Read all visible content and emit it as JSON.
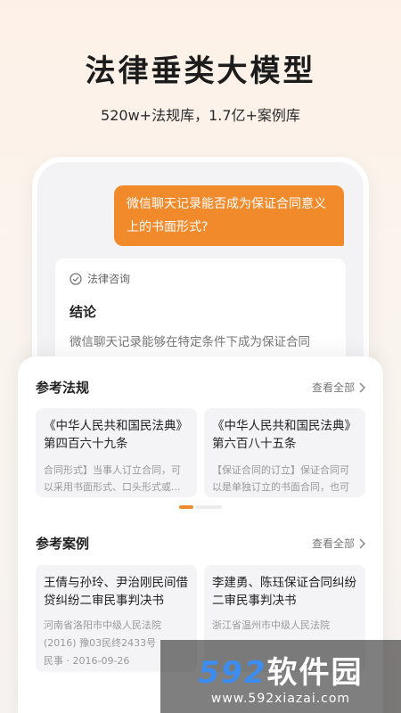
{
  "hero": {
    "title": "法律垂类大模型",
    "subtitle": "520w+法规库，1.7亿+案例库"
  },
  "chat": {
    "question": "微信聊天记录能否成为保证合同意义上的书面形式?",
    "answer_tag": "法律咨询",
    "answer_heading": "结论",
    "answer_text": "微信聊天记录能够在特定条件下成为保证合同"
  },
  "regulations": {
    "title": "参考法规",
    "view_all": "查看全部",
    "cards": [
      {
        "title": "《中华人民共和国民法典》第四百六十九条",
        "snippet": "合同形式】当事人订立合同，可以采用书面形式、口头形式或..."
      },
      {
        "title": "《中华人民共和国民法典》第六百八十五条",
        "snippet": "【保证合同的订立】保证合同可以是单独订立的书面合同，也可"
      }
    ]
  },
  "cases": {
    "title": "参考案例",
    "view_all": "查看全部",
    "cards": [
      {
        "title": "王倩与孙玲、尹治刚民间借贷纠纷二审民事判决书",
        "court": "河南省洛阳市中级人民法院",
        "case_no": "(2016) 豫03民终2433号",
        "meta": "民事 · 2016-09-26"
      },
      {
        "title": "李建勇、陈珏保证合同纠纷二审民事判决书",
        "court": "浙江省温州市中级人民法院",
        "case_no": "",
        "meta": ""
      }
    ]
  },
  "watermark": {
    "logo_num": "592",
    "logo_text": "软件园",
    "url": "www.592xiazai.com"
  },
  "colors": {
    "accent": "#f08a2b",
    "bubble_text": "#ffffff"
  },
  "icons": {
    "answer_tag": "check-circle-icon",
    "view_all": "chevron-right-icon"
  }
}
